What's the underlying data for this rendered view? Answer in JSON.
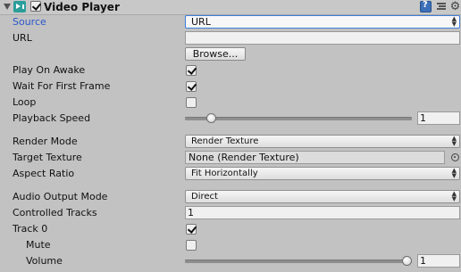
{
  "component": {
    "title": "Video Player",
    "enabled": true,
    "icons": [
      "foldout-arrow-icon",
      "video-player-icon",
      "help-icon",
      "preset-icon",
      "gear-icon"
    ]
  },
  "fields": {
    "source": {
      "label": "Source",
      "value": "URL"
    },
    "url": {
      "label": "URL",
      "value": "",
      "browse_label": "Browse..."
    },
    "play_on_awake": {
      "label": "Play On Awake",
      "checked": true
    },
    "wait_first_frame": {
      "label": "Wait For First Frame",
      "checked": true
    },
    "loop": {
      "label": "Loop",
      "checked": false
    },
    "playback_speed": {
      "label": "Playback Speed",
      "value": "1",
      "fraction": 0.1
    },
    "render_mode": {
      "label": "Render Mode",
      "value": "Render Texture"
    },
    "target_texture": {
      "label": "Target Texture",
      "value": "None (Render Texture)"
    },
    "aspect_ratio": {
      "label": "Aspect Ratio",
      "value": "Fit Horizontally"
    },
    "audio_output_mode": {
      "label": "Audio Output Mode",
      "value": "Direct"
    },
    "controlled_tracks": {
      "label": "Controlled Tracks",
      "value": "1"
    },
    "track0": {
      "label": "Track 0",
      "checked": true
    },
    "mute": {
      "label": "Mute",
      "checked": false
    },
    "volume": {
      "label": "Volume",
      "value": "1",
      "fraction": 1.0
    }
  },
  "colors": {
    "background": "#c2c2c2",
    "selected_label": "#2b57c9",
    "focus_border": "#3d7fd9",
    "component_icon": "#2b9e9b"
  }
}
